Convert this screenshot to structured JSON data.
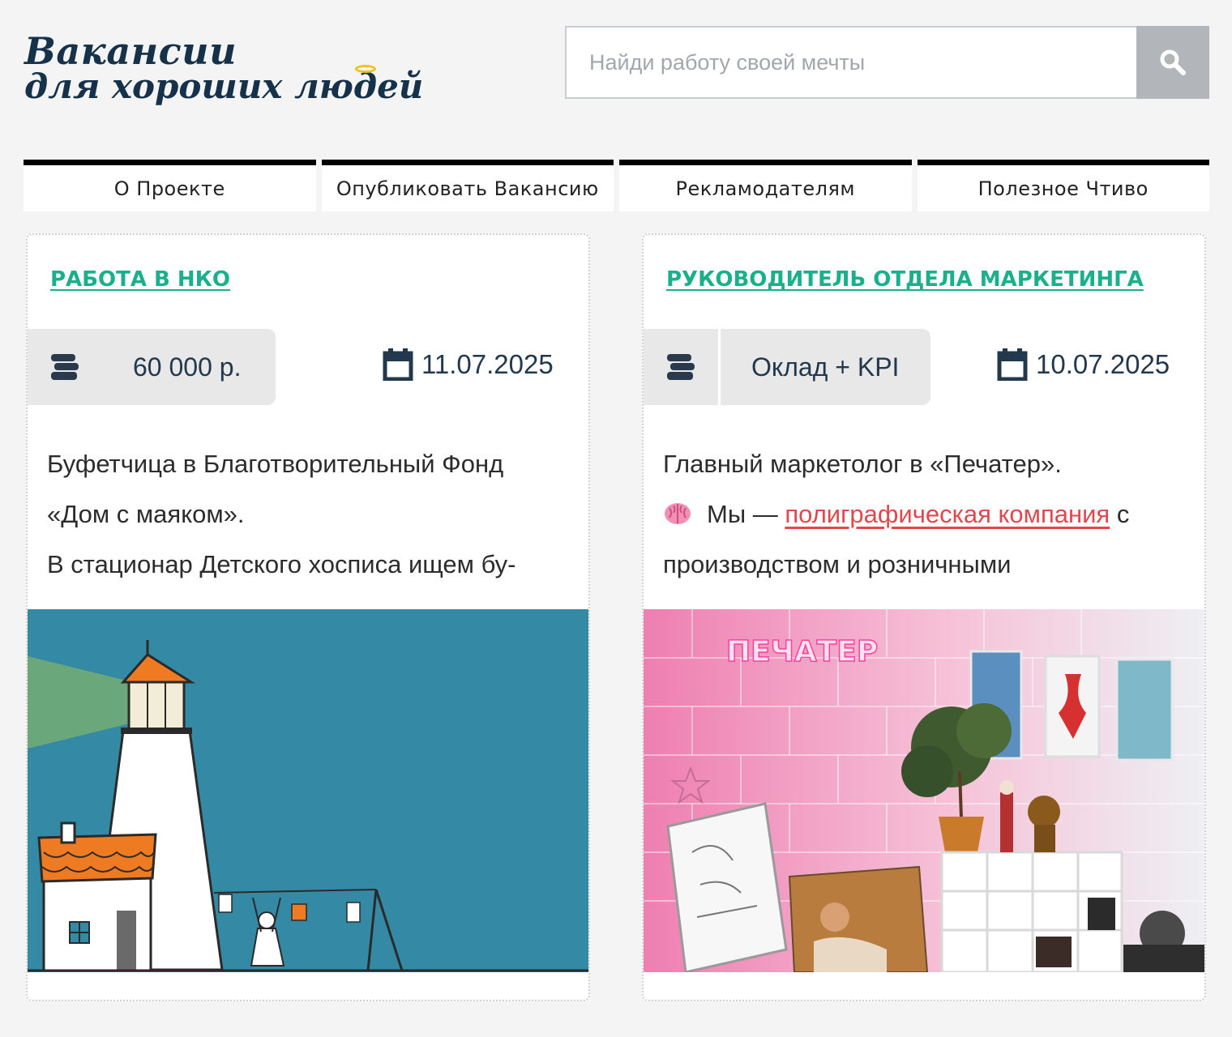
{
  "logo": {
    "line1": "Вакансии",
    "line2": "для хороших людей"
  },
  "search": {
    "placeholder": "Найди работу своей мечты",
    "icon": "search-icon"
  },
  "nav": [
    {
      "label": "О Проекте"
    },
    {
      "label": "Опубликовать Вакансию"
    },
    {
      "label": "Рекламодателям"
    },
    {
      "label": "Полезное Чтиво"
    }
  ],
  "cards": [
    {
      "category": "РАБОТА В НКО",
      "salary": "60 000 р.",
      "date": "11.07.2025",
      "lines": [
        "Буфетчица в Благотворительный Фонд",
        "«Дом с маяком».",
        "В стационар Детского хосписа ищем бу-"
      ],
      "image": "lighthouse-illustration"
    },
    {
      "category": "РУКОВОДИТЕЛЬ ОТДЕЛА МАРКЕТИНГА",
      "salary": "Оклад + KPI",
      "date": "10.07.2025",
      "lines": [
        "Главный маркетолог в «Печатер».",
        "Мы — ",
        "полиграфическая компания",
        " с",
        "производством и розничными"
      ],
      "image": "office-photo",
      "neon_sign": "ПЕЧАТЕР"
    }
  ],
  "colors": {
    "accent": "#19b08b",
    "link": "#e0484e",
    "navy": "#15324a"
  }
}
